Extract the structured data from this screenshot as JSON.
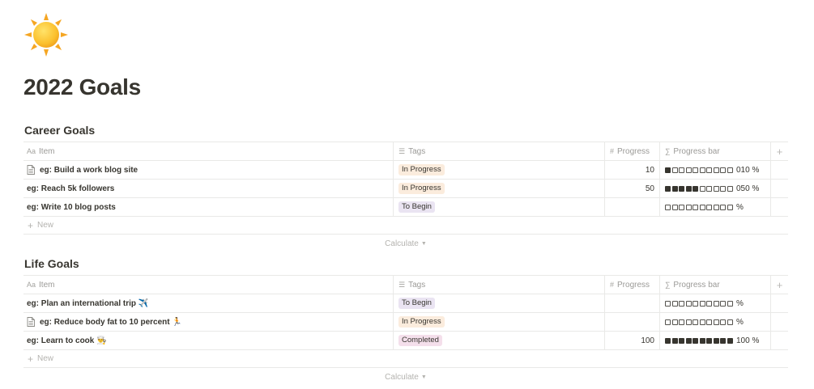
{
  "page": {
    "icon": "sun-emoji",
    "title": "2022 Goals"
  },
  "columns": {
    "item": "Item",
    "tags": "Tags",
    "progress": "Progress",
    "progress_bar": "Progress bar"
  },
  "icons": {
    "item_column": "Aa",
    "tags_column": "☰",
    "progress_column": "#",
    "bar_column": "∑",
    "add_column": "+"
  },
  "tag_colors": {
    "In Progress": "#fbecdd",
    "To Begin": "#eae4f2",
    "Completed": "#f4dfeb"
  },
  "sections": [
    {
      "title": "Career Goals",
      "rows": [
        {
          "item": "eg: Build a work blog site",
          "doc_icon": true,
          "tag": "In Progress",
          "progress": "10",
          "progress_value": 10,
          "bar_label": "010 %"
        },
        {
          "item": "eg: Reach 5k followers",
          "doc_icon": false,
          "tag": "In Progress",
          "progress": "50",
          "progress_value": 50,
          "bar_label": "050 %"
        },
        {
          "item": "eg: Write 10 blog posts",
          "doc_icon": false,
          "tag": "To Begin",
          "progress": "",
          "progress_value": 0,
          "bar_label": " %"
        }
      ],
      "new_label": "New",
      "calculate_label": "Calculate"
    },
    {
      "title": "Life Goals",
      "rows": [
        {
          "item": "eg: Plan an international trip ✈️",
          "doc_icon": false,
          "tag": "To Begin",
          "progress": "",
          "progress_value": 0,
          "bar_label": " %"
        },
        {
          "item": "eg: Reduce body fat to 10 percent 🏃",
          "doc_icon": true,
          "tag": "In Progress",
          "progress": "",
          "progress_value": 0,
          "bar_label": " %"
        },
        {
          "item": "eg: Learn to cook 👨‍🍳",
          "doc_icon": false,
          "tag": "Completed",
          "progress": "100",
          "progress_value": 100,
          "bar_label": "100 %"
        }
      ],
      "new_label": "New",
      "calculate_label": "Calculate"
    }
  ]
}
